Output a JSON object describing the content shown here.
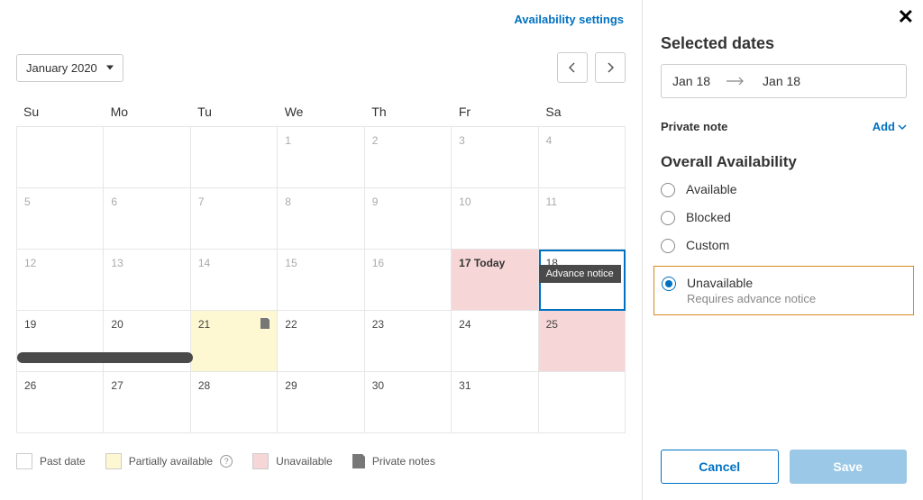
{
  "header": {
    "availability_link": "Availability settings",
    "month_label": "January 2020"
  },
  "weekday_headers": [
    "Su",
    "Mo",
    "Tu",
    "We",
    "Th",
    "Fr",
    "Sa"
  ],
  "cells": [
    {
      "label": "",
      "kind": "empty"
    },
    {
      "label": "",
      "kind": "empty"
    },
    {
      "label": "",
      "kind": "empty"
    },
    {
      "label": "1",
      "kind": "muted"
    },
    {
      "label": "2",
      "kind": "muted"
    },
    {
      "label": "3",
      "kind": "muted"
    },
    {
      "label": "4",
      "kind": "muted"
    },
    {
      "label": "5",
      "kind": "muted"
    },
    {
      "label": "6",
      "kind": "muted"
    },
    {
      "label": "7",
      "kind": "muted"
    },
    {
      "label": "8",
      "kind": "muted"
    },
    {
      "label": "9",
      "kind": "muted"
    },
    {
      "label": "10",
      "kind": "muted"
    },
    {
      "label": "11",
      "kind": "muted"
    },
    {
      "label": "12",
      "kind": "muted"
    },
    {
      "label": "13",
      "kind": "muted"
    },
    {
      "label": "14",
      "kind": "muted"
    },
    {
      "label": "15",
      "kind": "muted"
    },
    {
      "label": "16",
      "kind": "muted"
    },
    {
      "label": "17 Today",
      "kind": "today"
    },
    {
      "label": "18",
      "kind": "selected",
      "pill": "Advance notice"
    },
    {
      "label": "19",
      "kind": "normal"
    },
    {
      "label": "20",
      "kind": "normal"
    },
    {
      "label": "21",
      "kind": "partial",
      "note": true
    },
    {
      "label": "22",
      "kind": "normal"
    },
    {
      "label": "23",
      "kind": "normal"
    },
    {
      "label": "24",
      "kind": "normal"
    },
    {
      "label": "25",
      "kind": "unavail"
    },
    {
      "label": "26",
      "kind": "normal"
    },
    {
      "label": "27",
      "kind": "normal"
    },
    {
      "label": "28",
      "kind": "normal"
    },
    {
      "label": "29",
      "kind": "normal"
    },
    {
      "label": "30",
      "kind": "normal"
    },
    {
      "label": "31",
      "kind": "normal"
    },
    {
      "label": "",
      "kind": "empty"
    }
  ],
  "legend": {
    "past": "Past date",
    "partial": "Partially available",
    "unavail": "Unavailable",
    "notes": "Private notes"
  },
  "panel": {
    "title": "Selected dates",
    "start": "Jan 18",
    "end": "Jan 18",
    "note_label": "Private note",
    "add_label": "Add",
    "avail_title": "Overall Availability",
    "options": [
      {
        "label": "Available"
      },
      {
        "label": "Blocked"
      },
      {
        "label": "Custom"
      },
      {
        "label": "Unavailable",
        "sub": "Requires advance notice",
        "selected": true
      }
    ],
    "cancel": "Cancel",
    "save": "Save"
  }
}
